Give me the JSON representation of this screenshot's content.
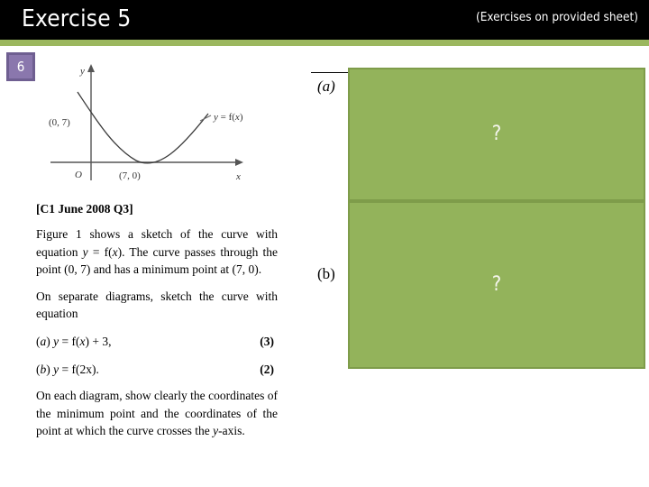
{
  "header": {
    "title": "Exercise 5",
    "note": "(Exercises on provided sheet)",
    "accent_color": "#9bb75e",
    "background_color": "#000000"
  },
  "slide_number": {
    "value": "6",
    "fill_color": "#8a77ad",
    "border_color": "#6f5f91"
  },
  "figure": {
    "name": "curve-sketch-f-of-x",
    "axis_labels": {
      "x": "x",
      "y": "y"
    },
    "origin_label": "O",
    "curve_label": "y = f(x)",
    "point_labels": [
      "(0, 7)",
      "(7, 0)"
    ],
    "description": "Sketch of a parabola-like curve passing through (0, 7) with a minimum at (7, 0)"
  },
  "question": {
    "source": "[C1 June 2008 Q3]",
    "intro": "Figure 1 shows a sketch of the curve with equation y = f(x). The curve passes through the point (0, 7) and has a minimum point at (7, 0).",
    "instruction": "On separate diagrams, sketch the curve with equation",
    "parts": [
      {
        "label": "(a)",
        "equation": "y = f(x) + 3,",
        "marks": "(3)"
      },
      {
        "label": "(b)",
        "equation": "y = f(2x).",
        "marks": "(2)"
      }
    ],
    "closing": "On each diagram, show clearly the coordinates of the minimum point and the coordinates of the point at which the curve crosses the y-axis."
  },
  "answers": {
    "fill_color": "#93b35b",
    "border_color": "#7e9c4a",
    "placeholder": "?",
    "items": [
      {
        "label": "(a)",
        "content": "?"
      },
      {
        "label": "(b)",
        "content": "?"
      }
    ]
  }
}
